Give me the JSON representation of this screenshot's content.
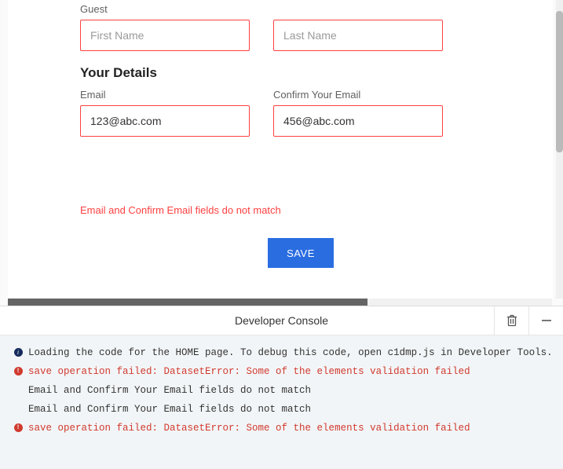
{
  "form": {
    "guest_label": "Guest",
    "first_name": {
      "placeholder": "First Name",
      "value": ""
    },
    "last_name": {
      "placeholder": "Last Name",
      "value": ""
    },
    "details_title": "Your Details",
    "email_label": "Email",
    "confirm_label": "Confirm Your Email",
    "email": {
      "placeholder": "",
      "value": "123@abc.com"
    },
    "confirm": {
      "placeholder": "",
      "value": "456@abc.com"
    },
    "error": "Email and Confirm Email fields do not match",
    "save_label": "SAVE"
  },
  "console": {
    "title": "Developer Console",
    "lines": [
      {
        "kind": "info",
        "text": "Loading the code for the HOME page. To debug this code, open c1dmp.js in Developer Tools."
      },
      {
        "kind": "error",
        "text": "save operation failed: DatasetError: Some of the elements validation failed"
      },
      {
        "kind": "plain",
        "text": "Email and Confirm Your Email fields do not match"
      },
      {
        "kind": "plain",
        "text": "Email and Confirm Your Email fields do not match"
      },
      {
        "kind": "error",
        "text": "save operation failed: DatasetError: Some of the elements validation failed"
      }
    ]
  }
}
